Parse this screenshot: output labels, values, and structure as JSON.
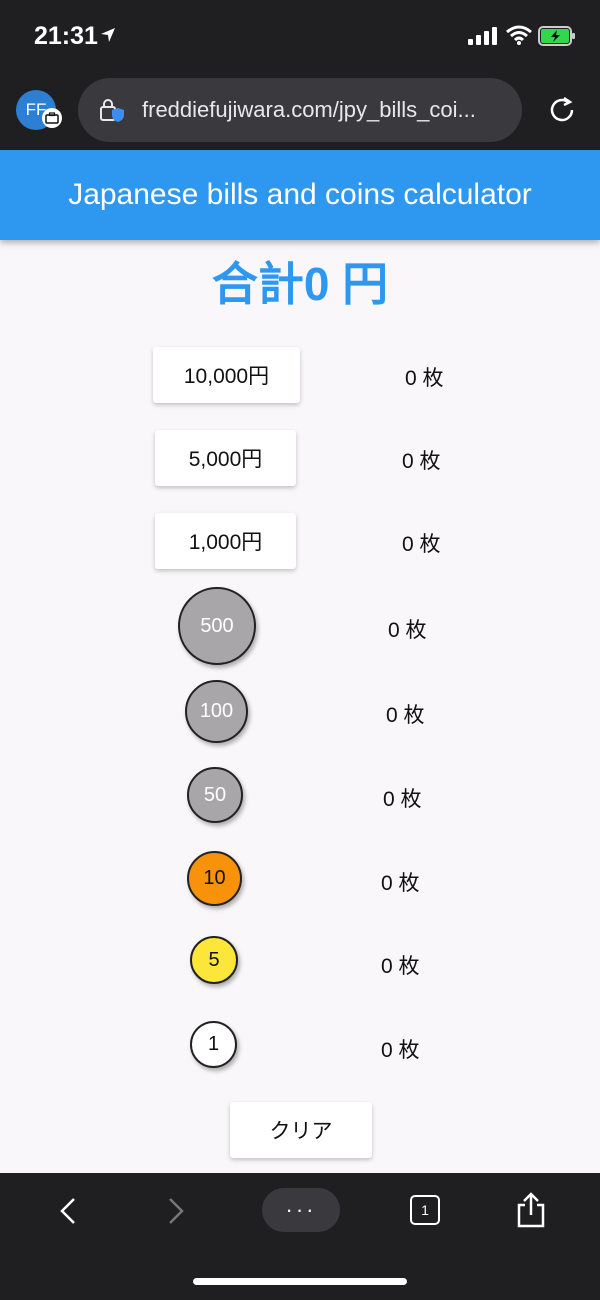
{
  "status_bar": {
    "time": "21:31"
  },
  "browser": {
    "profile_initials": "FF",
    "url": "freddiefujiwara.com/jpy_bills_coi...",
    "tab_count": "1",
    "menu_label": "···"
  },
  "app": {
    "title": "Japanese bills and coins calculator",
    "total": "合計0 円",
    "bills": [
      {
        "label": "10,000円",
        "count": "0 枚"
      },
      {
        "label": "5,000円",
        "count": "0 枚"
      },
      {
        "label": "1,000円",
        "count": "0 枚"
      }
    ],
    "coins": [
      {
        "label": "500",
        "count": "0 枚",
        "color": "#a9a6a9",
        "text_color": "#ffffff"
      },
      {
        "label": "100",
        "count": "0 枚",
        "color": "#a9a6a9",
        "text_color": "#ffffff"
      },
      {
        "label": "50",
        "count": "0 枚",
        "color": "#a9a6a9",
        "text_color": "#ffffff"
      },
      {
        "label": "10",
        "count": "0 枚",
        "color": "#f8920a",
        "text_color": "#111111"
      },
      {
        "label": "5",
        "count": "0 枚",
        "color": "#fde63a",
        "text_color": "#111111"
      },
      {
        "label": "1",
        "count": "0 枚",
        "color": "#ffffff",
        "text_color": "#111111"
      }
    ],
    "clear_label": "クリア",
    "accent_color": "#2e98f0"
  }
}
